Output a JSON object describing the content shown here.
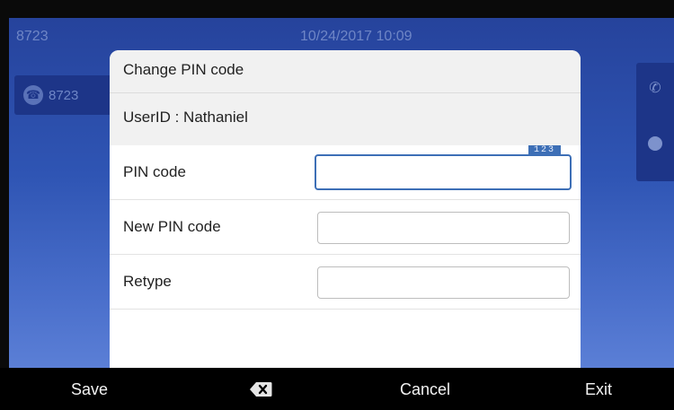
{
  "status": {
    "line_number": "8723",
    "datetime": "10/24/2017 10:09"
  },
  "line_key": {
    "label": "8723",
    "icon": "handset-icon"
  },
  "side_panel": {
    "icons": [
      "call-forward-icon",
      "voicemail-icon"
    ]
  },
  "dialog": {
    "title": "Change PIN code",
    "user_id": "UserID : Nathaniel",
    "fields": [
      {
        "label": "PIN code",
        "value": "",
        "ime_mode": "123"
      },
      {
        "label": "New PIN code",
        "value": ""
      },
      {
        "label": "Retype",
        "value": ""
      }
    ]
  },
  "softkeys": {
    "save": "Save",
    "backspace_icon": "backspace-icon",
    "cancel": "Cancel",
    "exit": "Exit"
  },
  "colors": {
    "focus": "#3d6fb6",
    "background_top": "#26439c",
    "background_bottom": "#5b7fd6"
  }
}
